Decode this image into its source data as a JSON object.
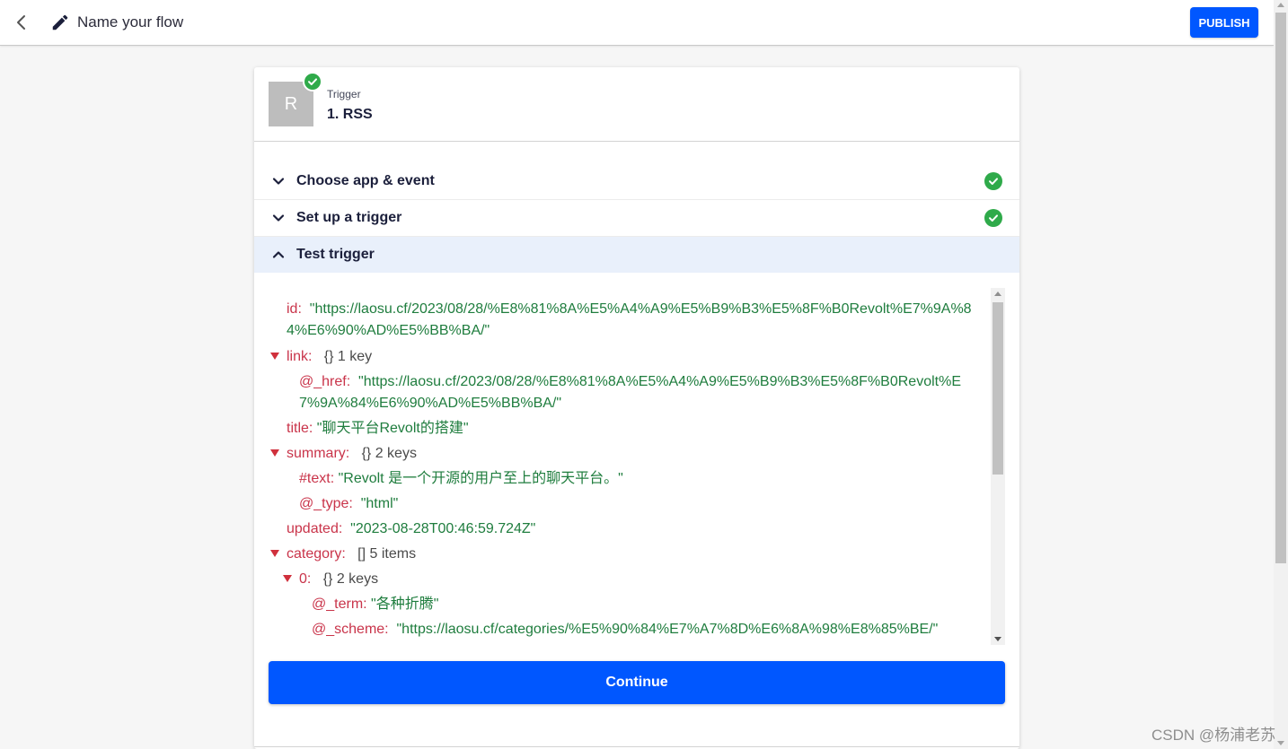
{
  "header": {
    "flow_name": "Name your flow",
    "publish_label": "PUBLISH"
  },
  "trigger": {
    "avatar_letter": "R",
    "kicker": "Trigger",
    "name": "1. RSS"
  },
  "sections": [
    {
      "label": "Choose app & event",
      "state": "complete"
    },
    {
      "label": "Set up a trigger",
      "state": "complete"
    },
    {
      "label": "Test trigger",
      "state": "expanded"
    }
  ],
  "data_viewer": {
    "id_key": "id:",
    "id_value": "\"https://laosu.cf/2023/08/28/%E8%81%8A%E5%A4%A9%E5%B9%B3%E5%8F%B0Revolt%E7%9A%84%E6%90%AD%E5%BB%BA/\"",
    "link_key": "link:",
    "link_meta": "{}  1 key",
    "href_key": "@_href:",
    "href_value": "\"https://laosu.cf/2023/08/28/%E8%81%8A%E5%A4%A9%E5%B9%B3%E5%8F%B0Revolt%E7%9A%84%E6%90%AD%E5%BB%BA/\"",
    "title_key": "title:",
    "title_value": "\"聊天平台Revolt的搭建\"",
    "summary_key": "summary:",
    "summary_meta": "{}  2 keys",
    "text_key": "#text:",
    "text_value": "\"Revolt 是一个开源的用户至上的聊天平台。\"",
    "type_key": "@_type:",
    "type_value": "\"html\"",
    "updated_key": "updated:",
    "updated_value": "\"2023-08-28T00:46:59.724Z\"",
    "category_key": "category:",
    "category_meta": "[]  5 items",
    "zero_key": "0:",
    "zero_meta": "{}  2 keys",
    "term_key": "@_term:",
    "term_value": "\"各种折腾\"",
    "scheme_key": "@_scheme:",
    "scheme_value": "\"https://laosu.cf/categories/%E5%90%84%E7%A7%8D%E6%8A%98%E8%85%BE/\""
  },
  "continue_label": "Continue",
  "watermark": "CSDN @杨浦老苏",
  "colors": {
    "accent": "#0057ff",
    "success": "#2faa4a",
    "json_key": "#c9344a",
    "json_value": "#1f7d3e"
  }
}
